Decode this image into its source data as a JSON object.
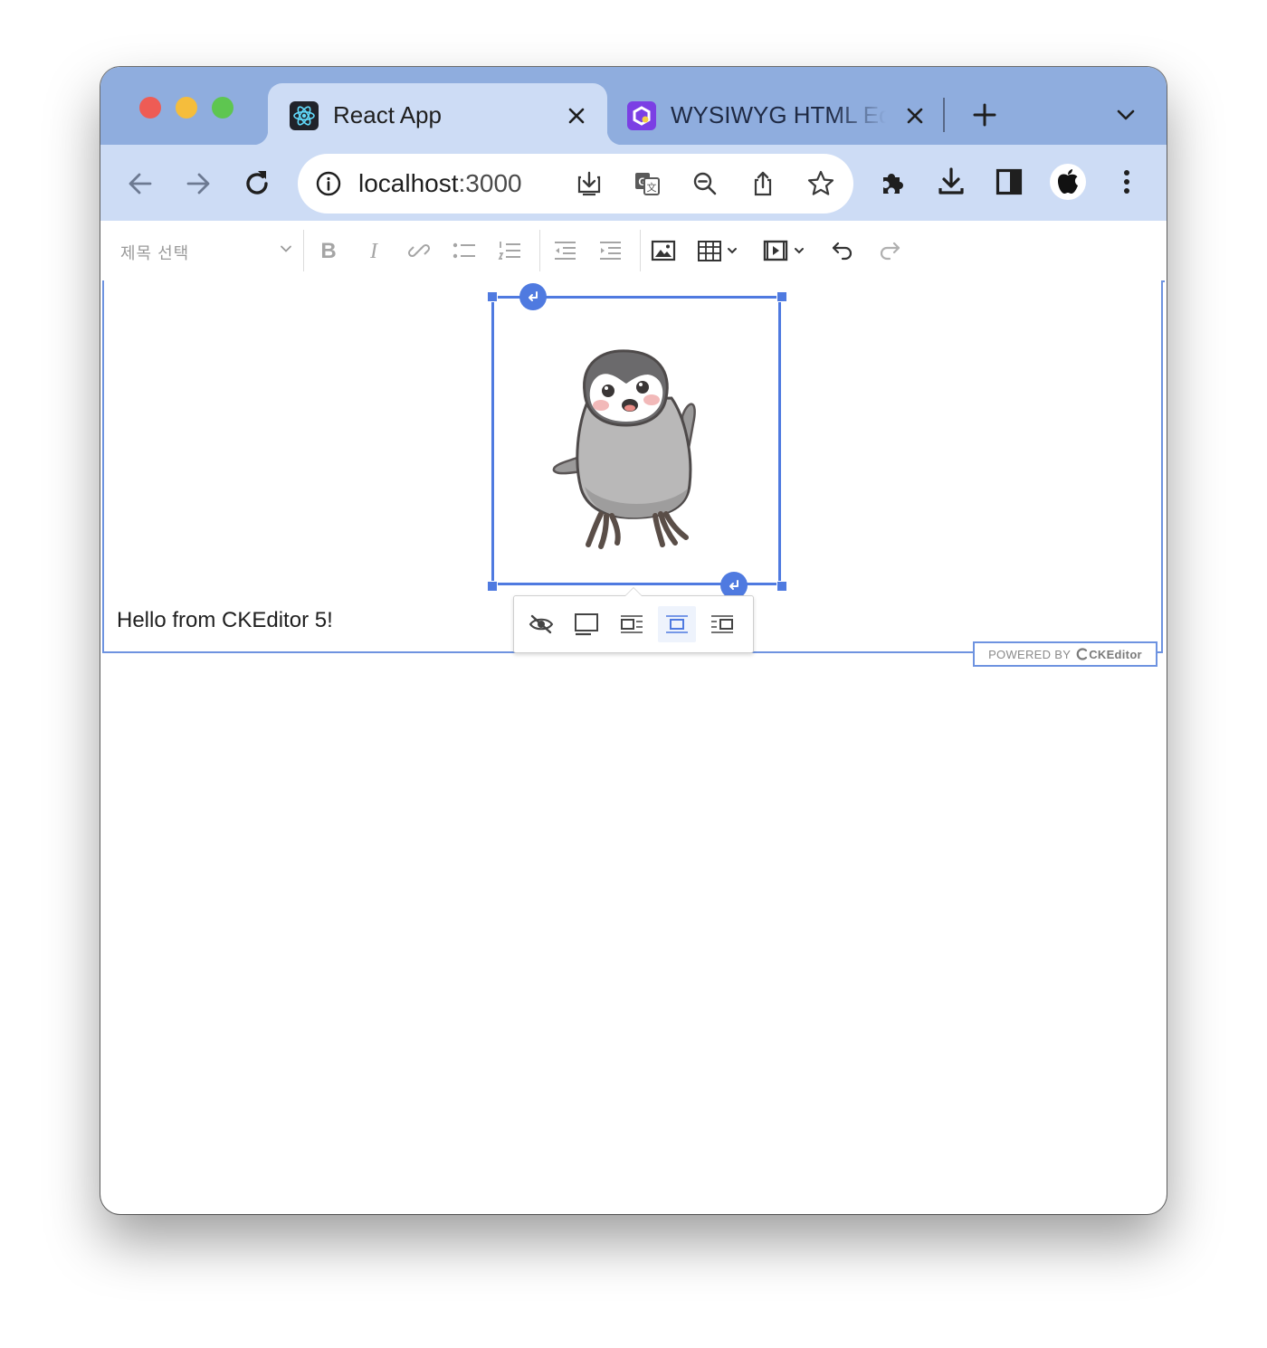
{
  "browser": {
    "tabs": [
      {
        "title": "React App",
        "active": true,
        "favicon": "react-icon"
      },
      {
        "title": "WYSIWYG HTML Editor",
        "active": false,
        "favicon": "ckeditor-icon"
      }
    ],
    "address": {
      "host": "localhost",
      "port": ":3000"
    },
    "colors": {
      "frame": "#8fadde",
      "toolbar": "#cddcf5",
      "accent": "#4f7ae0"
    }
  },
  "editor": {
    "heading_dropdown": "제목 선택",
    "toolbar_buttons": [
      "bold",
      "italic",
      "link",
      "bulleted-list",
      "numbered-list",
      "outdent",
      "indent",
      "insert-image",
      "insert-table",
      "insert-media",
      "undo",
      "redo"
    ],
    "content": {
      "paragraph": "Hello from CKEditor 5!"
    },
    "image_toolbar": [
      "toggle-caption",
      "full-size-image",
      "side-image",
      "centered-image",
      "wrap-text"
    ],
    "image_toolbar_active": "centered-image",
    "powered_by": {
      "prefix": "POWERED BY",
      "brand": "CKEditor"
    }
  }
}
